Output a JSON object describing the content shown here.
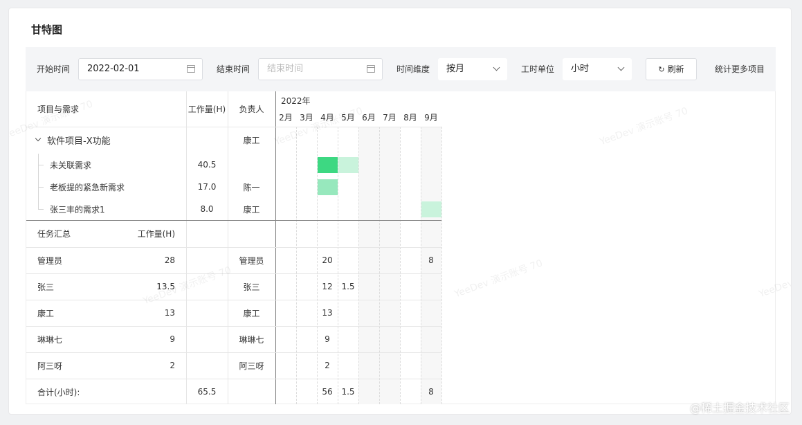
{
  "page": {
    "title": "甘特图",
    "watermark": "YeeDev 演示账号 70",
    "site_mark": "@稀土掘金技术社区"
  },
  "toolbar": {
    "start_label": "开始时间",
    "start_value": "2022-02-01",
    "end_label": "结束时间",
    "end_placeholder": "结束时间",
    "dimension_label": "时间维度",
    "dimension_value": "按月",
    "unit_label": "工时单位",
    "unit_value": "小时",
    "refresh_icon": "refresh-icon",
    "refresh_label": "刷新",
    "more_link": "统计更多项目"
  },
  "columns": {
    "name": "项目与需求",
    "hours": "工作量(H)",
    "owner": "负责人",
    "year": "2022年",
    "months": [
      "2月",
      "3月",
      "4月",
      "5月",
      "6月",
      "7月",
      "8月",
      "9月"
    ]
  },
  "project": {
    "name": "软件项目-X功能",
    "owner": "康工",
    "requirements": [
      {
        "name": "未关联需求",
        "hours": "40.5",
        "owner": ""
      },
      {
        "name": "老板提的紧急新需求",
        "hours": "17.0",
        "owner": "陈一"
      },
      {
        "name": "张三丰的需求1",
        "hours": "8.0",
        "owner": "康工"
      }
    ]
  },
  "gantt_bars": [
    {
      "row": 0,
      "start_month_index": 2,
      "span_months": 1,
      "color": "#3dd882"
    },
    {
      "row": 0,
      "start_month_index": 3,
      "span_months": 1,
      "color": "#c9f3dc"
    },
    {
      "row": 1,
      "start_month_index": 2,
      "span_months": 1,
      "color": "#97e8bd"
    },
    {
      "row": 2,
      "start_month_index": 7,
      "span_months": 1,
      "color": "#c9f3dc"
    }
  ],
  "summary": {
    "title": "任务汇总",
    "hours_label": "工作量(H)",
    "people": [
      {
        "name": "管理员",
        "hours": "28",
        "owner": "管理员",
        "months": [
          "",
          "",
          "20",
          "",
          "",
          "",
          "",
          "8"
        ]
      },
      {
        "name": "张三",
        "hours": "13.5",
        "owner": "张三",
        "months": [
          "",
          "",
          "12",
          "1.5",
          "",
          "",
          "",
          ""
        ]
      },
      {
        "name": "康工",
        "hours": "13",
        "owner": "康工",
        "months": [
          "",
          "",
          "13",
          "",
          "",
          "",
          "",
          ""
        ]
      },
      {
        "name": "琳琳七",
        "hours": "9",
        "owner": "琳琳七",
        "months": [
          "",
          "",
          "9",
          "",
          "",
          "",
          "",
          ""
        ]
      },
      {
        "name": "阿三呀",
        "hours": "2",
        "owner": "阿三呀",
        "months": [
          "",
          "",
          "2",
          "",
          "",
          "",
          "",
          ""
        ]
      }
    ],
    "total_label": "合计(小时):",
    "total_hours": "65.5",
    "total_months": [
      "",
      "",
      "56",
      "1.5",
      "",
      "",
      "",
      "8"
    ]
  }
}
